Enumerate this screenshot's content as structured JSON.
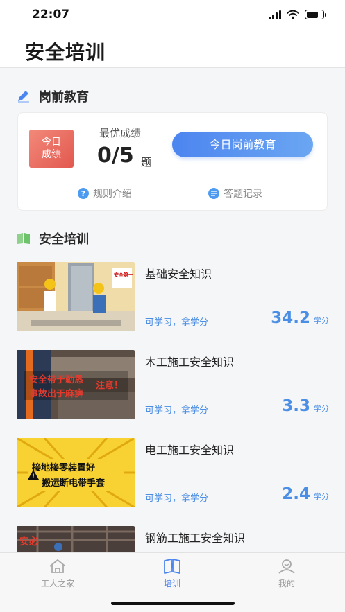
{
  "status_bar": {
    "time": "22:07"
  },
  "header": {
    "title": "安全培训"
  },
  "pre_shift": {
    "section_title": "岗前教育",
    "today_badge_line1": "今日",
    "today_badge_line2": "成绩",
    "best_score_label": "最优成绩",
    "score": "0/5",
    "score_unit": "题",
    "start_button": "今日岗前教育",
    "rules_link": "规则介绍",
    "records_link": "答题记录"
  },
  "training": {
    "section_title": "安全培训",
    "courses": [
      {
        "title": "基础安全知识",
        "tagline": "可学习，拿学分",
        "credit": "34.2",
        "credit_unit": "学分",
        "thumb_text": "安全第一"
      },
      {
        "title": "木工施工安全知识",
        "tagline": "可学习，拿学分",
        "credit": "3.3",
        "credit_unit": "学分",
        "thumb_text1": "安全带于勤恳",
        "thumb_text2": "事故出于麻痹",
        "thumb_text3": "注意！"
      },
      {
        "title": "电工施工安全知识",
        "tagline": "可学习，拿学分",
        "credit": "2.4",
        "credit_unit": "学分",
        "thumb_text1": "接地接零装置好",
        "thumb_text2": "搬运断电带手套"
      },
      {
        "title": "钢筋工施工安全知识",
        "thumb_text": "安必"
      }
    ]
  },
  "tab_bar": {
    "tabs": [
      {
        "label": "工人之家",
        "icon": "home-icon"
      },
      {
        "label": "培训",
        "icon": "book-icon",
        "active": true
      },
      {
        "label": "我的",
        "icon": "user-icon"
      }
    ]
  },
  "colors": {
    "accent": "#4d85f0",
    "badge_red": "#e2584f",
    "credit_blue": "#4a8ee6"
  }
}
